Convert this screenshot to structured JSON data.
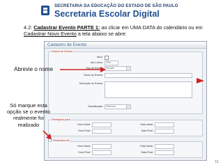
{
  "header": {
    "brand_top": "SECRETARIA DA EDUCAÇÃO DO ESTADO DE SÃO PAULO",
    "brand_main": "Secretaria Escolar Digital",
    "logo_icon": "sp-state-logo-icon"
  },
  "instruction": {
    "prefix": "4.2: ",
    "bold": "Cadastrar Evento PARTE 1:",
    "mid": " ao clicar em UMA DATA do calendário ou em ",
    "link": "Cadastrar Novo Evento",
    "suffix": " a tela abaixo se abre:"
  },
  "annotations": {
    "name_note": "Abrevie o nome",
    "period_note": "Só marque esta opção se o evento realmente foi realizado",
    "arrow_color": "#d42020"
  },
  "form": {
    "title": "Cadastro de Evento",
    "section_event": "Dados do Evento",
    "label_ativo": "Ativo:",
    "label_ano": "Ano Letivo:",
    "value_ano": "2024",
    "label_tipo": "Tipo de Evento:",
    "value_tipo": "Reunião",
    "label_nome": "Nome do Evento:",
    "label_descricao": "Descrição do Evento:",
    "label_classificacao": "Classificação:",
    "value_classificacao": "Selecione",
    "section_planned": "Planejado para",
    "section_done": "Realizado em",
    "label_hora_inicial": "Hora Inicial:",
    "label_data_inicial": "Data Inicial:",
    "label_hora_final": "Hora Final:",
    "label_data_final": "Data Final:"
  },
  "page_number": "11"
}
